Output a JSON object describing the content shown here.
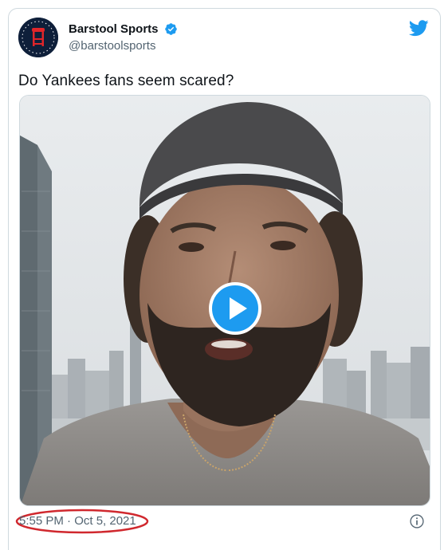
{
  "tweet": {
    "display_name": "Barstool Sports",
    "handle": "@barstoolsports",
    "verified": true,
    "text": "Do Yankees fans seem scared?",
    "timestamp": "5:55 PM · Oct 5, 2021",
    "media_type": "video"
  },
  "icons": {
    "brand": "twitter-bird-icon",
    "verified": "verified-badge-icon",
    "play": "play-icon",
    "info": "info-icon",
    "avatar": "barstool-logo"
  },
  "colors": {
    "twitter_blue": "#1d9bf0",
    "highlight_red": "#d0282e",
    "secondary_text": "#536471"
  }
}
